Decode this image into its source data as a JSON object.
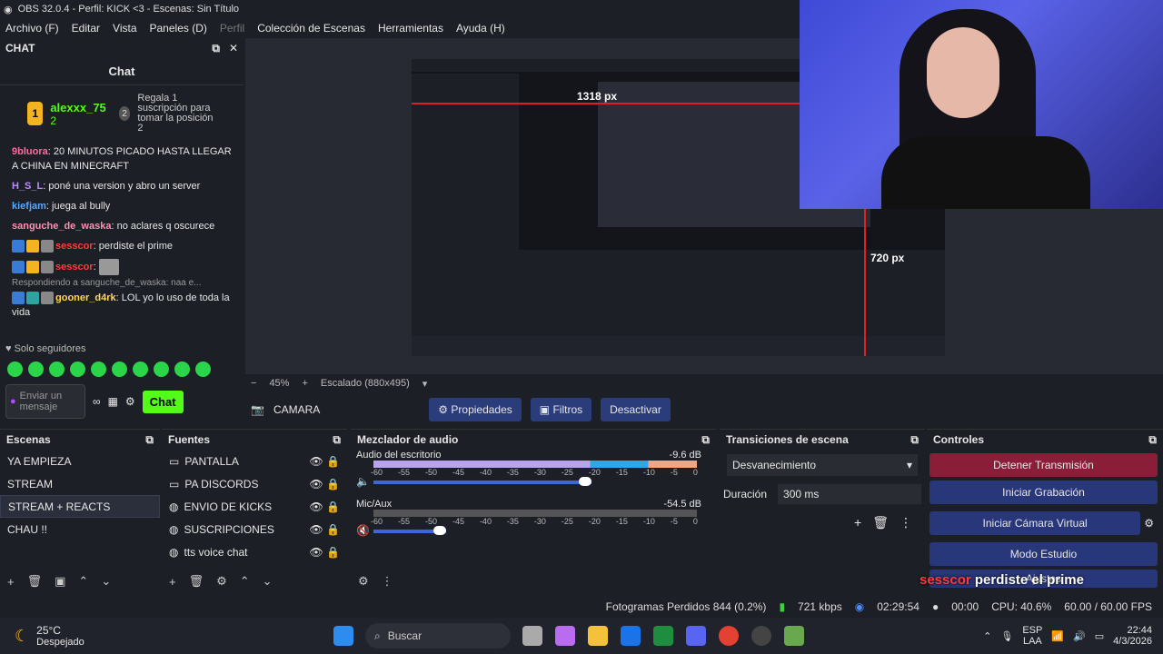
{
  "window": {
    "title": "OBS 32.0.4 - Perfil: KICK <3 - Escenas: Sin Título"
  },
  "menu": {
    "items": [
      "Archivo (F)",
      "Editar",
      "Vista",
      "Paneles (D)",
      "Perfil",
      "Colección de Escenas",
      "Herramientas",
      "Ayuda (H)"
    ]
  },
  "chat": {
    "dock_title": "CHAT",
    "title": "Chat",
    "gift": {
      "rank": "1",
      "user": "alexxx_75",
      "count": "2",
      "rank2": "2",
      "text": "Regala 1 suscripción para tomar la posición 2"
    },
    "messages": [
      {
        "user": "9bluora",
        "text": "20 MINUTOS PICADO HASTA LLEGAR A CHINA EN MINECRAFT"
      },
      {
        "user": "H_S_L",
        "text": "poné una version y abro un server"
      },
      {
        "user": "kiefjam",
        "text": "juega al bully"
      },
      {
        "user": "sanguche_de_waska",
        "text": "no aclares q oscurece"
      },
      {
        "user": "sesscor",
        "text": "perdiste el prime"
      },
      {
        "user": "sesscor",
        "text": ""
      },
      {
        "user": "gooner_d4rk",
        "text": "LOL yo lo uso de toda la vida",
        "reply": "Respondiendo a sanguche_de_waska: naa e..."
      }
    ],
    "followers_label": "Solo seguidores",
    "input_placeholder": "Enviar un mensaje",
    "send_label": "Chat"
  },
  "preview": {
    "measure_h": "1318 px",
    "measure_v": "720 px"
  },
  "zoom": {
    "minus": "−",
    "value": "45%",
    "plus": "+",
    "scaling": "Escalado (880x495)"
  },
  "source_toolbar": {
    "source": "CAMARA",
    "props": "Propiedades",
    "filters": "Filtros",
    "deactivate": "Desactivar"
  },
  "scenes": {
    "title": "Escenas",
    "items": [
      "YA EMPIEZA",
      "STREAM",
      "STREAM + REACTS",
      "CHAU !!"
    ],
    "selected": 2
  },
  "sources": {
    "title": "Fuentes",
    "items": [
      {
        "icon": "monitor-icon",
        "name": "PANTALLA"
      },
      {
        "icon": "window-icon",
        "name": "PA DISCORDS"
      },
      {
        "icon": "globe-icon",
        "name": "ENVIO DE KICKS"
      },
      {
        "icon": "globe-icon",
        "name": "SUSCRIPCIONES"
      },
      {
        "icon": "globe-icon",
        "name": "tts voice chat"
      }
    ]
  },
  "mixer": {
    "title": "Mezclador de audio",
    "tracks": [
      {
        "name": "Audio del escritorio",
        "db": "-9.6 dB"
      },
      {
        "name": "Mic/Aux",
        "db": "-54.5 dB"
      }
    ],
    "scale": [
      "-60",
      "-55",
      "-50",
      "-45",
      "-40",
      "-35",
      "-30",
      "-25",
      "-20",
      "-15",
      "-10",
      "-5",
      "0"
    ]
  },
  "transitions": {
    "title": "Transiciones de escena",
    "type": "Desvanecimiento",
    "duration_label": "Duración",
    "duration": "300 ms"
  },
  "controls": {
    "title": "Controles",
    "buttons": [
      "Detener Transmisión",
      "Iniciar Grabación",
      "Iniciar Cámara Virtual",
      "Modo Estudio",
      "Ajustes"
    ]
  },
  "alert": {
    "user": "sesscor",
    "text": "perdiste el prime"
  },
  "status": {
    "dropped": "Fotogramas Perdidos 844 (0.2%)",
    "bitrate": "721 kbps",
    "live_time": "02:29:54",
    "rec_time": "00:00",
    "cpu": "CPU: 40.6%",
    "fps": "60.00 / 60.00 FPS"
  },
  "taskbar": {
    "temp": "25°C",
    "weather": "Despejado",
    "search": "Buscar",
    "lang1": "ESP",
    "lang2": "LAA",
    "time": "22:44",
    "date": "4/3/2026"
  }
}
